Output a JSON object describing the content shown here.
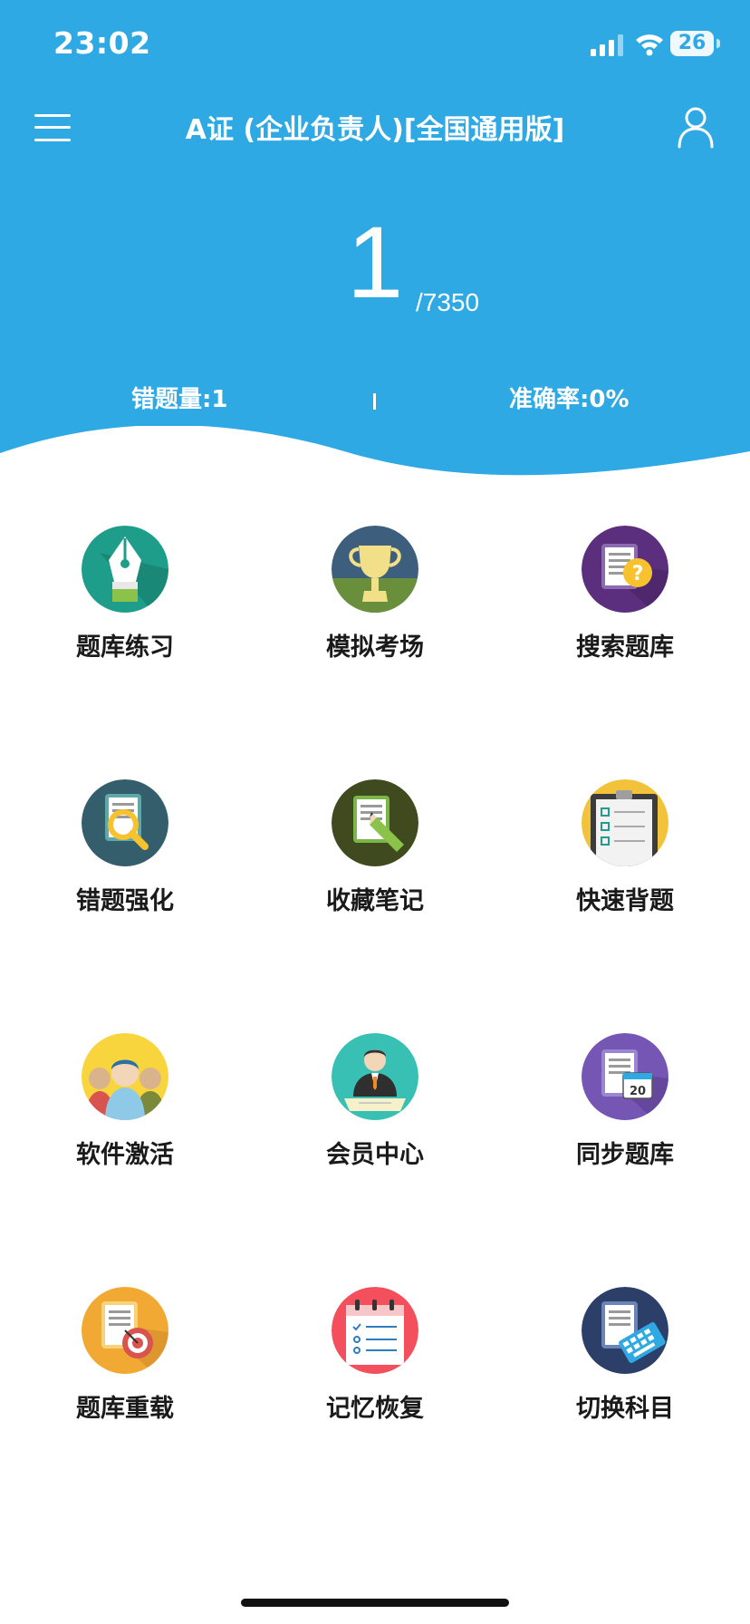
{
  "status_bar": {
    "time": "23:02",
    "battery": "26"
  },
  "nav": {
    "title": "A证 (企业负责人)[全国通用版]"
  },
  "progress": {
    "current": "1",
    "total": "/7350"
  },
  "stats": {
    "wrong": "错题量:1",
    "accuracy": "准确率:0%"
  },
  "colors": {
    "header_bg": "#2ea9e3",
    "text": "#1a1a1a"
  },
  "menu": [
    {
      "label": "题库练习",
      "icon": "pen-nib-icon",
      "color": "#1e9e8a"
    },
    {
      "label": "模拟考场",
      "icon": "trophy-icon",
      "color": "#3e5e7e"
    },
    {
      "label": "搜索题库",
      "icon": "question-search-icon",
      "color": "#5c2f7e"
    },
    {
      "label": "错题强化",
      "icon": "magnifier-icon",
      "color": "#355e6c"
    },
    {
      "label": "收藏笔记",
      "icon": "note-pen-icon",
      "color": "#3f4a1e"
    },
    {
      "label": "快速背题",
      "icon": "clipboard-checklist-icon",
      "color": "#f2c23a"
    },
    {
      "label": "软件激活",
      "icon": "people-group-icon",
      "color": "#f8d53c"
    },
    {
      "label": "会员中心",
      "icon": "member-person-icon",
      "color": "#39c0b4"
    },
    {
      "label": "同步题库",
      "icon": "calendar-document-icon",
      "color": "#7556b5"
    },
    {
      "label": "题库重载",
      "icon": "target-document-icon",
      "color": "#f2a933"
    },
    {
      "label": "记忆恢复",
      "icon": "checklist-calendar-icon",
      "color": "#f34f5c"
    },
    {
      "label": "切换科目",
      "icon": "keyboard-document-icon",
      "color": "#2c3f69"
    }
  ]
}
